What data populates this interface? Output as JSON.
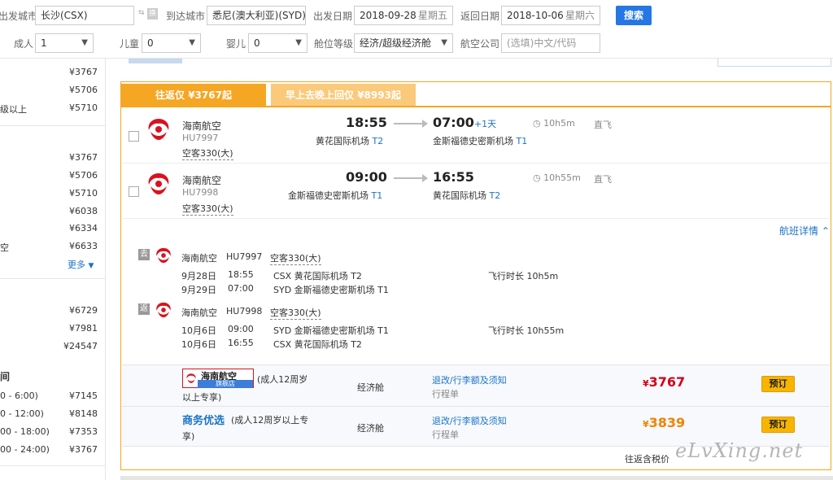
{
  "search": {
    "depart_city_label": "出发城市",
    "depart_city_value": "长沙(CSX)",
    "swap_label": "换",
    "arrive_city_label": "到达城市",
    "arrive_city_value": "悉尼(澳大利亚)(SYD)",
    "depart_date_label": "出发日期",
    "depart_date_value": "2018-09-28",
    "depart_weekday": "星期五",
    "return_date_label": "返回日期",
    "return_date_value": "2018-10-06",
    "return_weekday": "星期六",
    "search_button": "搜索",
    "adult_label": "成人",
    "adult_value": "1",
    "child_label": "儿童",
    "child_value": "0",
    "infant_label": "婴儿",
    "infant_value": "0",
    "cabin_label": "舱位等级",
    "cabin_value": "经济/超级经济舱",
    "airline_label": "航空公司",
    "airline_placeholder": "(选填)中文/代码"
  },
  "left_panel": {
    "group1": [
      {
        "label": "",
        "price": "¥3767"
      },
      {
        "label": "",
        "price": "¥5706"
      },
      {
        "label": "级以上",
        "price": "¥5710"
      }
    ],
    "group2": [
      {
        "label": "",
        "price": "¥3767"
      },
      {
        "label": "",
        "price": "¥5706"
      },
      {
        "label": "",
        "price": "¥5710"
      },
      {
        "label": "",
        "price": "¥6038"
      },
      {
        "label": "",
        "price": "¥6334"
      },
      {
        "label": "空",
        "price": "¥6633"
      }
    ],
    "more_label": "更多",
    "group3": [
      {
        "label": "",
        "price": "¥6729"
      },
      {
        "label": "",
        "price": "¥7981"
      },
      {
        "label": "",
        "price": "¥24547"
      }
    ],
    "group4_title": "间",
    "group4": [
      {
        "label": "0 - 6:00)",
        "price": "¥7145"
      },
      {
        "label": "0 - 12:00)",
        "price": "¥8148"
      },
      {
        "label": "00 - 18:00)",
        "price": "¥7353"
      },
      {
        "label": "00 - 24:00)",
        "price": "¥3767"
      }
    ]
  },
  "tabs": [
    {
      "label": "往返仅 ¥3767起"
    },
    {
      "label": "早上去晚上回仅 ¥8993起"
    }
  ],
  "outbound": {
    "airline": "海南航空",
    "flight_no": "HU7997",
    "aircraft": "空客330(大)",
    "dep_time": "18:55",
    "dep_airport": "黄花国际机场",
    "dep_terminal": "T2",
    "arr_time": "07:00",
    "arr_plus": "+1天",
    "arr_airport": "金斯福德史密斯机场",
    "arr_terminal": "T1",
    "duration": "10h5m",
    "type": "直飞"
  },
  "inbound": {
    "airline": "海南航空",
    "flight_no": "HU7998",
    "aircraft": "空客330(大)",
    "dep_time": "09:00",
    "dep_airport": "金斯福德史密斯机场",
    "dep_terminal": "T1",
    "arr_time": "16:55",
    "arr_airport": "黄花国际机场",
    "arr_terminal": "T2",
    "duration": "10h55m",
    "type": "直飞"
  },
  "details": {
    "toggle_label": "航班详情",
    "go_badge": "去",
    "back_badge": "返",
    "go": {
      "airline": "海南航空",
      "flight_no": "HU7997",
      "aircraft": "空客330(大)",
      "row1_date": "9月28日",
      "row1_time": "18:55",
      "row1_airport": "CSX 黄花国际机场 T2",
      "row2_date": "9月29日",
      "row2_time": "07:00",
      "row2_airport": "SYD 金斯福德史密斯机场 T1",
      "duration": "飞行时长 10h5m"
    },
    "back": {
      "airline": "海南航空",
      "flight_no": "HU7998",
      "aircraft": "空客330(大)",
      "row1_date": "10月6日",
      "row1_time": "09:00",
      "row1_airport": "SYD 金斯福德史密斯机场 T1",
      "row2_date": "10月6日",
      "row2_time": "16:55",
      "row2_airport": "CSX 黄花国际机场 T2",
      "duration": "飞行时长 10h55m"
    }
  },
  "offers": [
    {
      "vendor_top": "海南航空",
      "vendor_bottom": "旗舰店",
      "note": "(成人12周岁以上专享)",
      "note_line1": "(成人12周岁",
      "note_line2": "以上专享)",
      "cabin": "经济舱",
      "rules": "退改/行李额及须知",
      "ticket": "行程单",
      "currency": "¥",
      "price": "3767",
      "book": "预订"
    },
    {
      "vendor_name": "商务优选",
      "note_line1": "(成人12周岁以上专",
      "note_line2": "享)",
      "cabin": "经济舱",
      "rules": "退改/行李额及须知",
      "ticket": "行程单",
      "currency": "¥",
      "price": "3839",
      "book": "预订"
    }
  ],
  "footer_note": "往返含税价",
  "watermark": "eLvXing.net",
  "colors": {
    "accent_orange": "#f5a623",
    "tab_inactive": "#fbc97a",
    "price_red": "#d0021b",
    "price_orange": "#f08300",
    "link_blue": "#1a73c8",
    "hainan_red": "#d9121f"
  }
}
